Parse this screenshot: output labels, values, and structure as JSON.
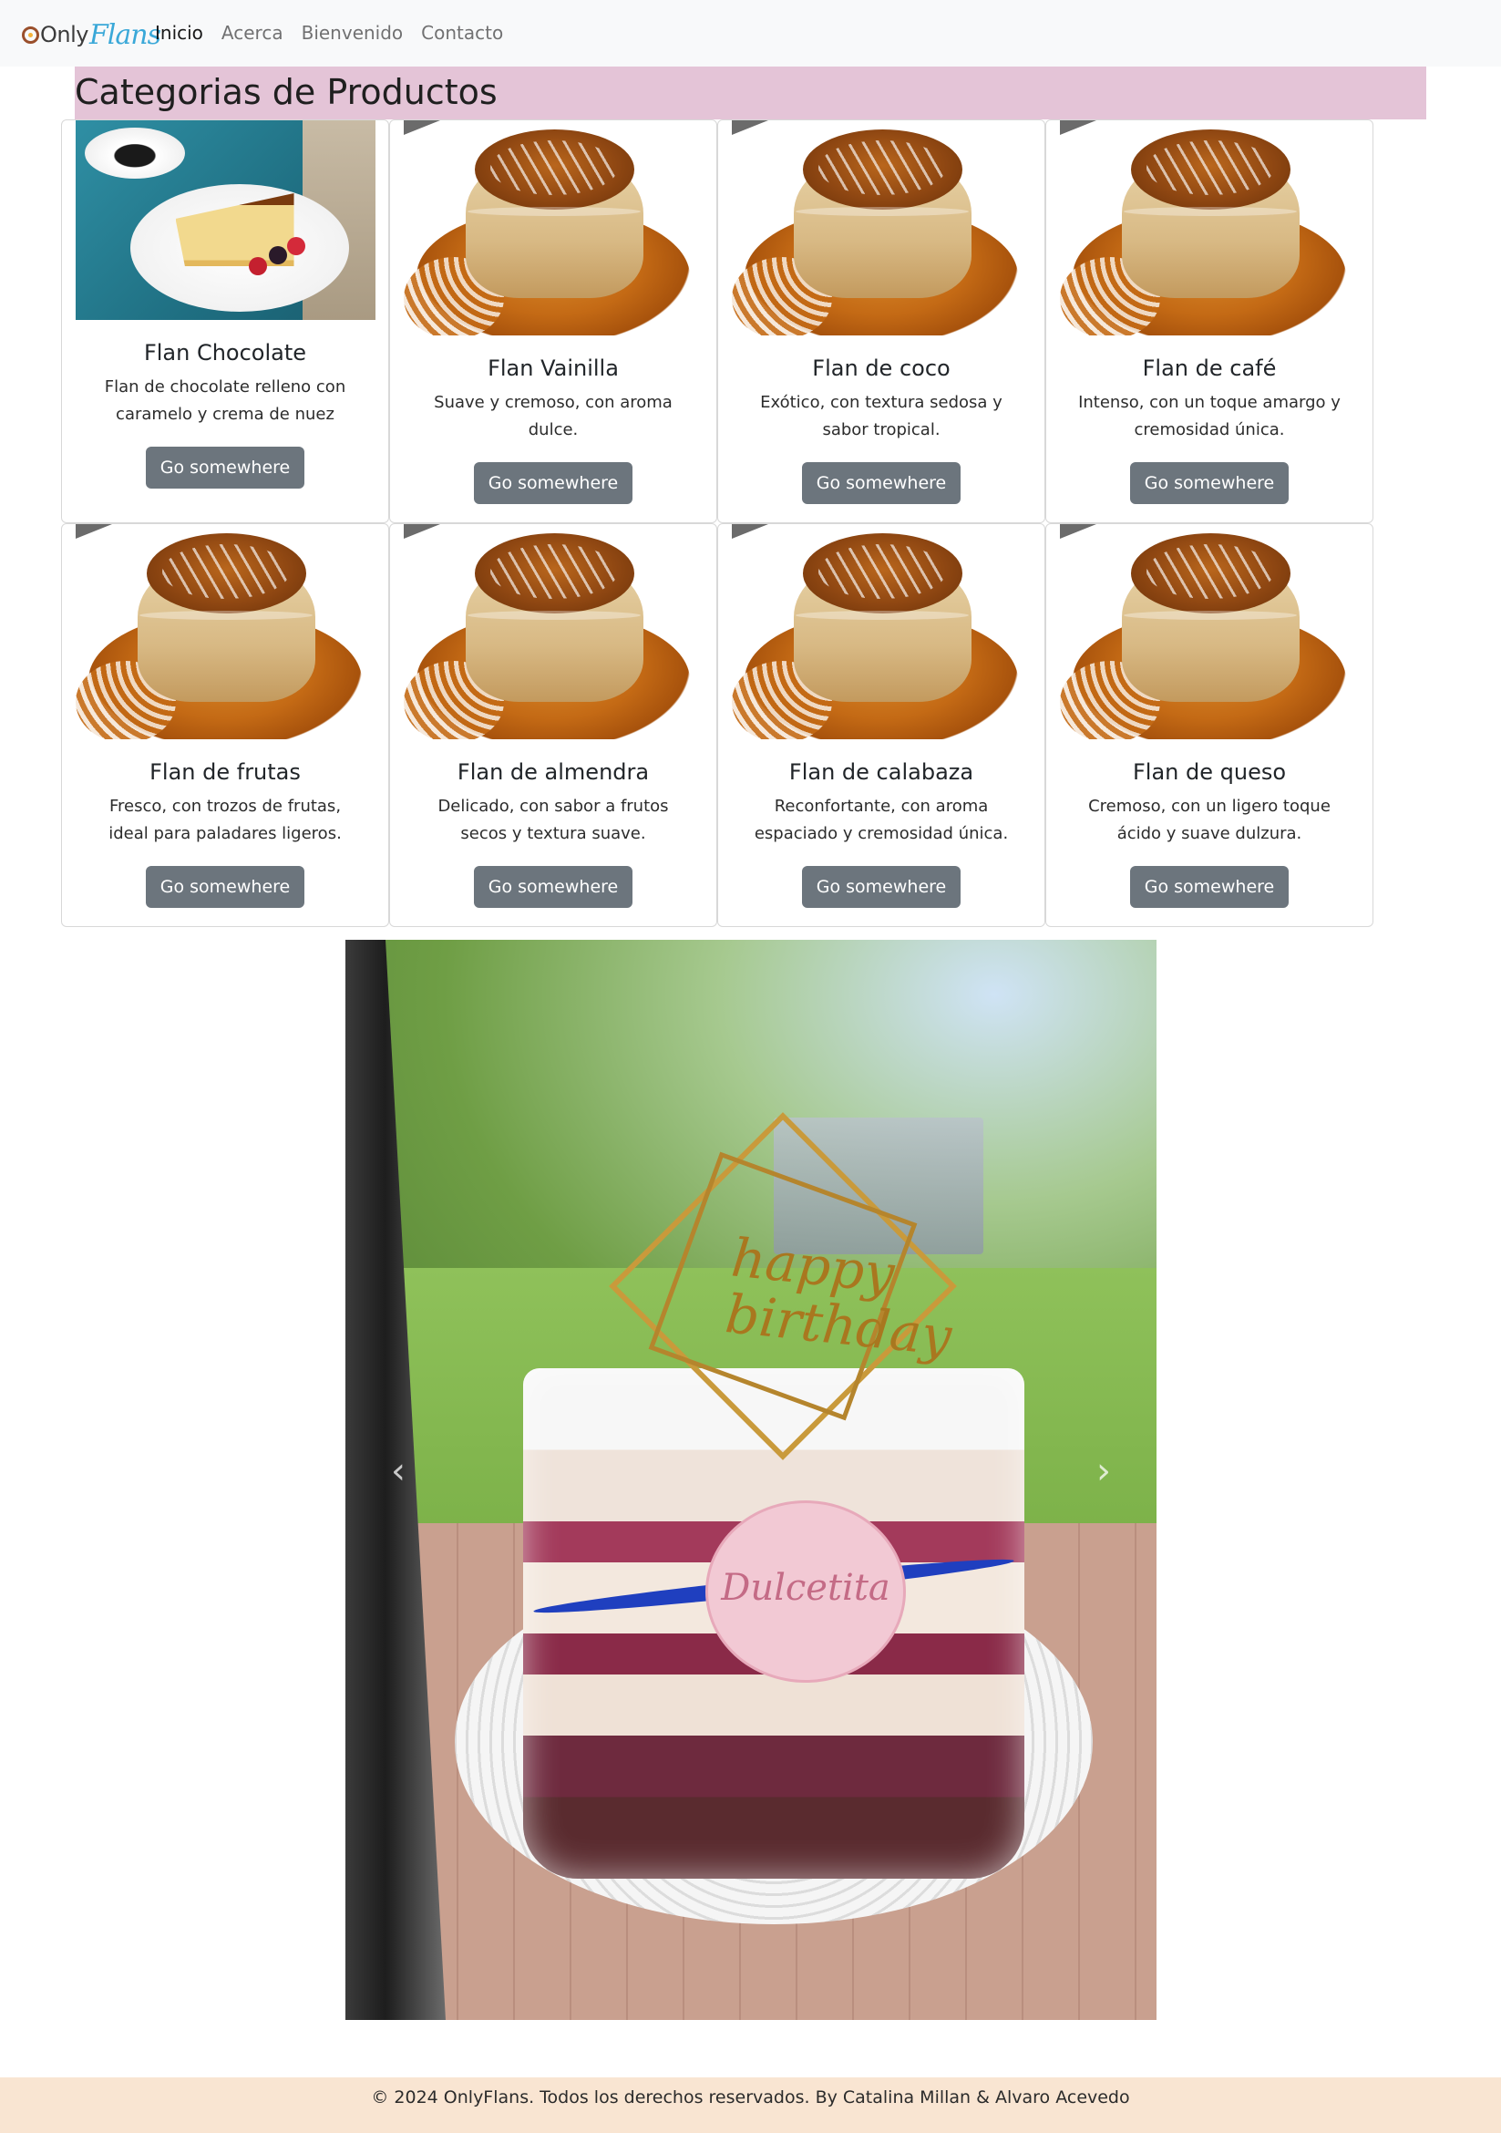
{
  "brand": {
    "only": "Only",
    "flans": "Flans"
  },
  "nav": [
    {
      "label": "Inicio",
      "active": true
    },
    {
      "label": "Acerca",
      "active": false
    },
    {
      "label": "Bienvenido",
      "active": false
    },
    {
      "label": "Contacto",
      "active": false
    }
  ],
  "section_title": "Categorias de Productos",
  "cards": [
    {
      "title": "Flan Chocolate",
      "text": "Flan de chocolate relleno con caramelo y crema de nuez",
      "button": "Go somewhere",
      "image": "plated-flan-with-coffee"
    },
    {
      "title": "Flan Vainilla",
      "text": "Suave y cremoso, con aroma dulce.",
      "button": "Go somewhere",
      "image": "caramel-flan"
    },
    {
      "title": "Flan de coco",
      "text": "Exótico, con textura sedosa y sabor tropical.",
      "button": "Go somewhere",
      "image": "caramel-flan"
    },
    {
      "title": "Flan de café",
      "text": "Intenso, con un toque amargo y cremosidad única.",
      "button": "Go somewhere",
      "image": "caramel-flan"
    },
    {
      "title": "Flan de frutas",
      "text": "Fresco, con trozos de frutas, ideal para paladares ligeros.",
      "button": "Go somewhere",
      "image": "caramel-flan"
    },
    {
      "title": "Flan de almendra",
      "text": "Delicado, con sabor a frutos secos y textura suave.",
      "button": "Go somewhere",
      "image": "caramel-flan"
    },
    {
      "title": "Flan de calabaza",
      "text": "Reconfortante, con aroma espaciado y cremosidad única.",
      "button": "Go somewhere",
      "image": "caramel-flan"
    },
    {
      "title": "Flan de queso",
      "text": "Cremoso, con un ligero toque ácido y suave dulzura.",
      "button": "Go somewhere",
      "image": "caramel-flan"
    }
  ],
  "carousel": {
    "topper_line1": "happy",
    "topper_line2": "birthday",
    "badge": "Dulcetita",
    "prev_icon": "‹",
    "next_icon": "›"
  },
  "footer": "© 2024 OnlyFlans. Todos los derechos reservados. By Catalina Millan & Alvaro Acevedo",
  "colors": {
    "navbar_bg": "#f8f9fa",
    "title_bg": "#e4c4d7",
    "button_bg": "#6c757d",
    "footer_bg": "#f9e5d2"
  }
}
